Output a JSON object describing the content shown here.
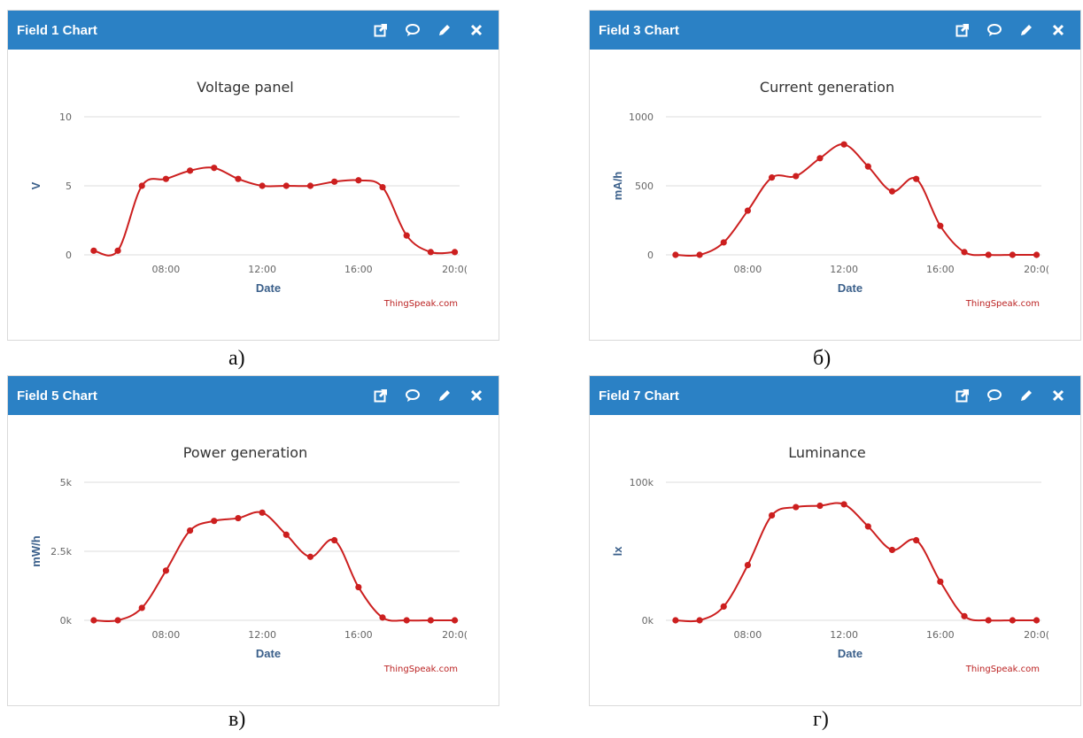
{
  "charts": [
    {
      "header": "Field 1 Chart",
      "caption": "а)",
      "chart_data": {
        "type": "line",
        "title": "Voltage panel",
        "xlabel": "Date",
        "ylabel": "V",
        "credit": "ThingSpeak.com",
        "color": "#cc1f1f",
        "x_ticks": [
          "08:00",
          "12:00",
          "16:00",
          "20:0("
        ],
        "y_ticks": [
          "0",
          "5",
          "10"
        ],
        "x_range": [
          4.6,
          20.2
        ],
        "ylim": [
          0,
          10
        ],
        "x": [
          5,
          6,
          7,
          8,
          9,
          10,
          11,
          12,
          13,
          14,
          15,
          16,
          17,
          18,
          19,
          20
        ],
        "y": [
          0.3,
          0.3,
          5.0,
          5.5,
          6.1,
          6.3,
          5.5,
          5.0,
          5.0,
          5.0,
          5.3,
          5.4,
          4.9,
          1.4,
          0.2,
          0.2
        ]
      }
    },
    {
      "header": "Field 3 Chart",
      "caption": "б)",
      "chart_data": {
        "type": "line",
        "title": "Current generation",
        "xlabel": "Date",
        "ylabel": "mA/h",
        "credit": "ThingSpeak.com",
        "color": "#cc1f1f",
        "x_ticks": [
          "08:00",
          "12:00",
          "16:00",
          "20:0("
        ],
        "y_ticks": [
          "0",
          "500",
          "1000"
        ],
        "x_range": [
          4.6,
          20.2
        ],
        "ylim": [
          0,
          1000
        ],
        "x": [
          5,
          6,
          7,
          8,
          9,
          10,
          11,
          12,
          13,
          14,
          15,
          16,
          17,
          18,
          19,
          20
        ],
        "y": [
          0,
          0,
          90,
          320,
          560,
          570,
          700,
          800,
          640,
          460,
          550,
          210,
          20,
          0,
          0,
          0
        ]
      }
    },
    {
      "header": "Field 5 Chart",
      "caption": "в)",
      "chart_data": {
        "type": "line",
        "title": "Power generation",
        "xlabel": "Date",
        "ylabel": "mW/h",
        "credit": "ThingSpeak.com",
        "color": "#cc1f1f",
        "x_ticks": [
          "08:00",
          "12:00",
          "16:00",
          "20:0("
        ],
        "y_ticks": [
          "0k",
          "2.5k",
          "5k"
        ],
        "x_range": [
          4.6,
          20.2
        ],
        "ylim": [
          0,
          5000
        ],
        "x": [
          5,
          6,
          7,
          8,
          9,
          10,
          11,
          12,
          13,
          14,
          15,
          16,
          17,
          18,
          19,
          20
        ],
        "y": [
          0,
          0,
          450,
          1800,
          3250,
          3600,
          3700,
          3900,
          3100,
          2300,
          2900,
          1200,
          100,
          0,
          0,
          0
        ]
      }
    },
    {
      "header": "Field 7 Chart",
      "caption": "г)",
      "chart_data": {
        "type": "line",
        "title": "Luminance",
        "xlabel": "Date",
        "ylabel": "lx",
        "credit": "ThingSpeak.com",
        "color": "#cc1f1f",
        "x_ticks": [
          "08:00",
          "12:00",
          "16:00",
          "20:0("
        ],
        "y_ticks": [
          "0k",
          "100k"
        ],
        "x_range": [
          4.6,
          20.2
        ],
        "ylim": [
          0,
          100000
        ],
        "x": [
          5,
          6,
          7,
          8,
          9,
          10,
          11,
          12,
          13,
          14,
          15,
          16,
          17,
          18,
          19,
          20
        ],
        "y": [
          0,
          0,
          10000,
          40000,
          76000,
          82000,
          83000,
          84000,
          68000,
          51000,
          58000,
          28000,
          3000,
          0,
          0,
          0
        ]
      }
    }
  ]
}
